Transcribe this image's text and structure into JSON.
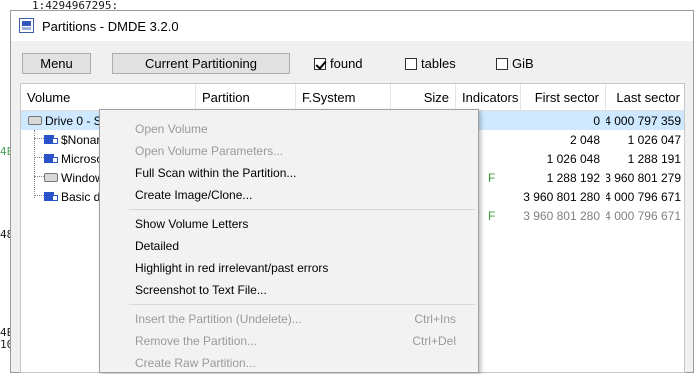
{
  "background": {
    "line1": "1:4294967295:",
    "line2": "4E",
    "line3": "48",
    "line4": "4E",
    "line5": "10"
  },
  "window": {
    "title": "Partitions - DMDE 3.2.0"
  },
  "toolbar": {
    "menu_label": "Menu",
    "current_partitioning_label": "Current Partitioning",
    "found_label": "found",
    "found_checked": true,
    "tables_label": "tables",
    "tables_checked": false,
    "gib_label": "GiB",
    "gib_checked": false
  },
  "table": {
    "headers": [
      "Volume",
      "Partition",
      "F.System",
      "Size",
      "Indicators",
      "First sector",
      "Last sector"
    ],
    "rows": [
      {
        "volume": "Drive 0 - S",
        "first": "0",
        "last": "4 000 797 359"
      },
      {
        "volume": "$Nonar",
        "first": "2 048",
        "last": "1 026 047"
      },
      {
        "volume": "Microsc",
        "first": "1 026 048",
        "last": "1 288 191"
      },
      {
        "volume": "Window",
        "indicator": "F",
        "first": "1 288 192",
        "last": "3 960 801 279"
      },
      {
        "volume": "Basic da",
        "first": "3 960 801 280",
        "last": "4 000 796 671"
      },
      {
        "volume": "",
        "indicator": "F",
        "first": "3 960 801 280",
        "last": "4 000 796 671"
      }
    ]
  },
  "context_menu": {
    "items": [
      {
        "label": "Open Volume",
        "shortcut": "",
        "disabled": true
      },
      {
        "label": "Open Volume Parameters...",
        "shortcut": "",
        "disabled": true
      },
      {
        "label": "Full Scan within the Partition...",
        "shortcut": "",
        "disabled": false
      },
      {
        "label": "Create Image/Clone...",
        "shortcut": "",
        "disabled": false
      },
      {
        "label": "Show Volume Letters",
        "shortcut": "",
        "disabled": false
      },
      {
        "label": "Detailed",
        "shortcut": "",
        "disabled": false
      },
      {
        "label": "Highlight in red irrelevant/past errors",
        "shortcut": "",
        "disabled": false
      },
      {
        "label": "Screenshot to Text File...",
        "shortcut": "",
        "disabled": false
      },
      {
        "label": "Insert the Partition (Undelete)...",
        "shortcut": "Ctrl+Ins",
        "disabled": true
      },
      {
        "label": "Remove the Partition...",
        "shortcut": "Ctrl+Del",
        "disabled": true
      },
      {
        "label": "Create Raw Partition...",
        "shortcut": "",
        "disabled": true
      }
    ]
  }
}
